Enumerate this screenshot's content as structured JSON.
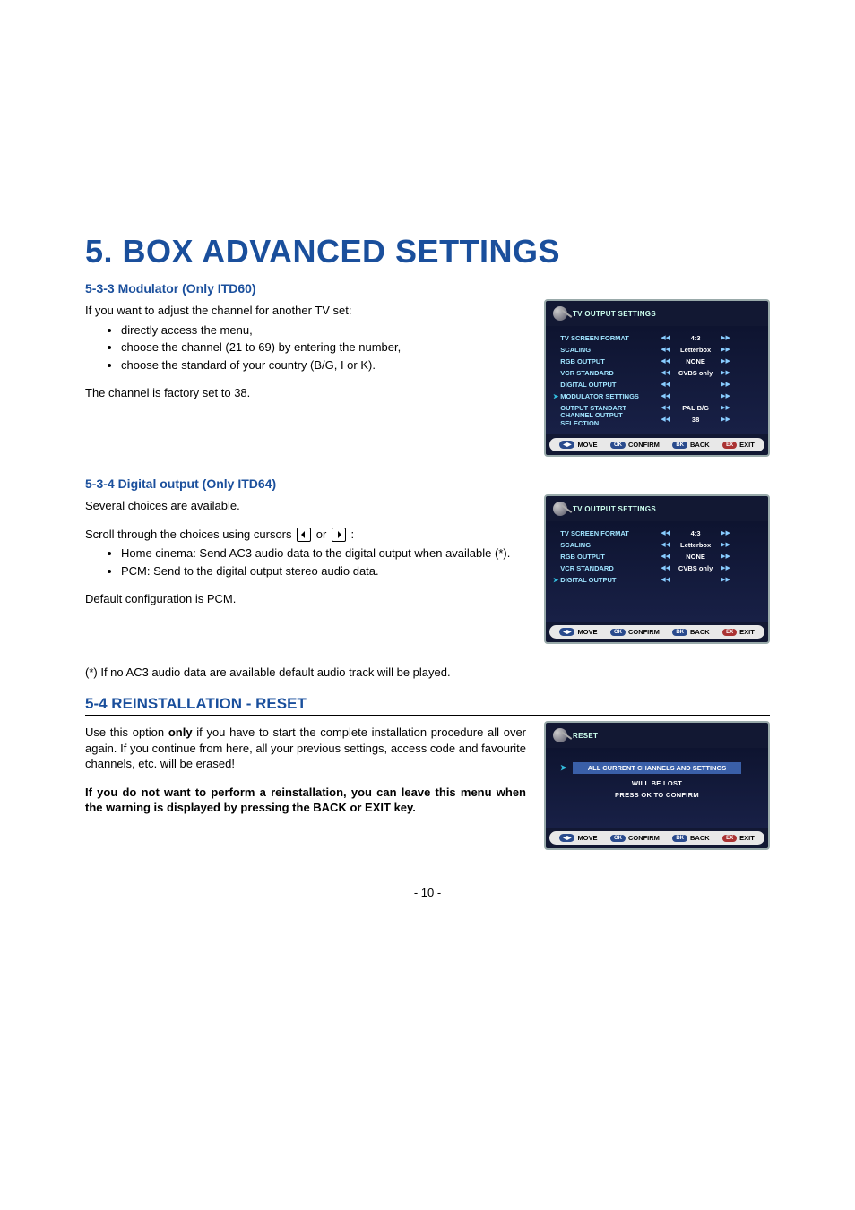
{
  "title": "5. BOX ADVANCED SETTINGS",
  "s533": {
    "heading": "5-3-3 Modulator (Only ITD60)",
    "intro": "If you want to adjust the channel for another TV set:",
    "bullets": [
      "directly access the menu,",
      "choose the channel (21 to 69) by entering the number,",
      "choose the standard of your country (B/G, I or K)."
    ],
    "note": "The channel is factory set to 38."
  },
  "s534": {
    "heading": "5-3-4 Digital output (Only ITD64)",
    "intro": "Several choices are available.",
    "scroll_pre": "Scroll through the choices using cursors ",
    "scroll_or": " or ",
    "scroll_post": " :",
    "bullets": [
      "Home cinema: Send AC3 audio data to the digital output when available (*).",
      "PCM: Send to the digital output stereo audio data."
    ],
    "default": "Default configuration is PCM."
  },
  "footnote": "(*) If no AC3 audio data are available default audio track will be played.",
  "s54": {
    "heading": "5-4 REINSTALLATION - RESET",
    "p1a": "Use this option ",
    "p1b_only": "only",
    "p1c": " if you have to start the complete installation procedure all over again. If you continue from here, all your previous settings, access code and favourite channels, etc. will be erased!",
    "p2": "If you do not want to perform a reinstallation, you can leave this menu when the warning is displayed by pressing the BACK or EXIT key."
  },
  "osd1": {
    "title": "TV OUTPUT SETTINGS",
    "rows": [
      {
        "label": "TV SCREEN FORMAT",
        "value": "4:3",
        "sel": false
      },
      {
        "label": "SCALING",
        "value": "Letterbox",
        "sel": false
      },
      {
        "label": "RGB OUTPUT",
        "value": "NONE",
        "sel": false
      },
      {
        "label": "VCR STANDARD",
        "value": "CVBS only",
        "sel": false
      },
      {
        "label": "DIGITAL OUTPUT",
        "value": "",
        "sel": false
      },
      {
        "label": "MODULATOR SETTINGS",
        "value": "",
        "sel": true
      },
      {
        "label": "OUTPUT STANDART",
        "value": "PAL B/G",
        "sel": false
      },
      {
        "label": "CHANNEL OUTPUT SELECTION",
        "value": "38",
        "sel": false
      }
    ]
  },
  "osd2": {
    "title": "TV OUTPUT SETTINGS",
    "rows": [
      {
        "label": "TV SCREEN FORMAT",
        "value": "4:3",
        "sel": false
      },
      {
        "label": "SCALING",
        "value": "Letterbox",
        "sel": false
      },
      {
        "label": "RGB OUTPUT",
        "value": "NONE",
        "sel": false
      },
      {
        "label": "VCR STANDARD",
        "value": "CVBS only",
        "sel": false
      },
      {
        "label": "DIGITAL OUTPUT",
        "value": "",
        "sel": true
      }
    ]
  },
  "osd3": {
    "title": "RESET",
    "line1": "ALL CURRENT CHANNELS AND SETTINGS",
    "line2": "WILL BE LOST",
    "line3": "PRESS OK TO CONFIRM"
  },
  "footer_buttons": {
    "move": "MOVE",
    "ok": "OK",
    "confirm": "CONFIRM",
    "bk": "BK",
    "back": "BACK",
    "ex": "EX",
    "exit": "EXIT",
    "nav": "◀▶"
  },
  "page_num": "- 10 -"
}
